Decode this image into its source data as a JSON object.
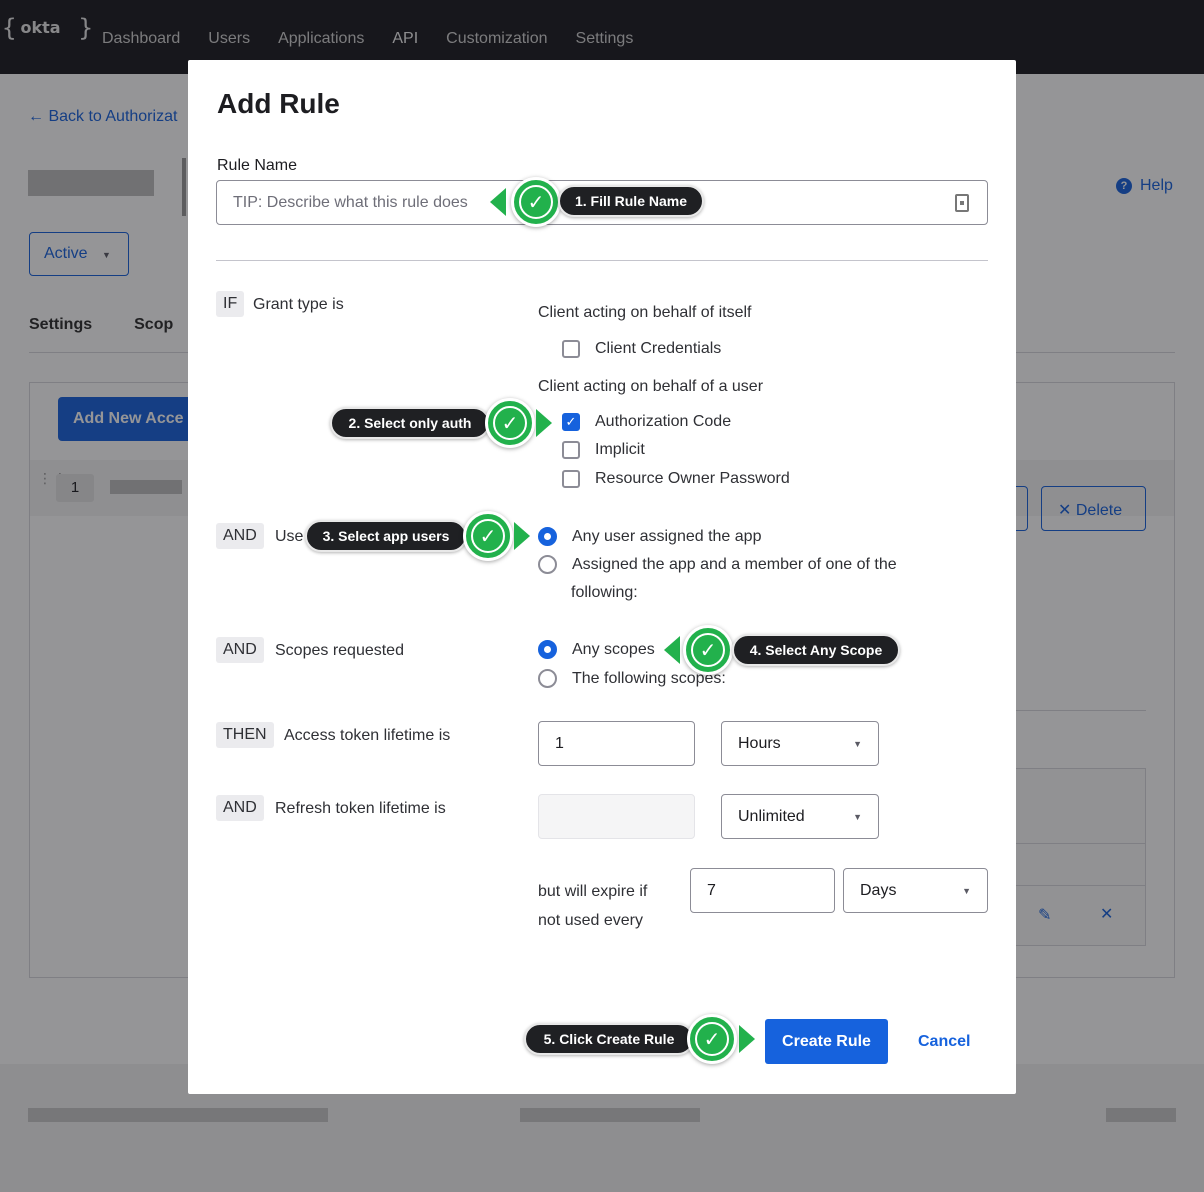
{
  "topbar": {
    "logo_text": "okta",
    "nav": [
      "Dashboard",
      "Users",
      "Applications",
      "API",
      "Customization",
      "Settings"
    ]
  },
  "background": {
    "back_link": "← Back to Authorizat",
    "help": "Help",
    "status_button": "Active",
    "tabs": [
      "Settings",
      "Scop"
    ],
    "add_button": "Add New Acce",
    "row_number": "1",
    "delete_button": "Delete"
  },
  "modal": {
    "title": "Add Rule",
    "rule_name_label": "Rule Name",
    "rule_name_placeholder": "TIP: Describe what this rule does",
    "grant": {
      "tag": "IF",
      "label": "Grant type is",
      "group_self": "Client acting on behalf of itself",
      "client_credentials": "Client Credentials",
      "group_user": "Client acting on behalf of a user",
      "authorization_code": "Authorization Code",
      "implicit": "Implicit",
      "resource_owner": "Resource Owner Password"
    },
    "user": {
      "tag": "AND",
      "label": "Use",
      "any_user": "Any user assigned the app",
      "assigned_member_line1": "Assigned the app and a member of one of the",
      "assigned_member_line2": "following:"
    },
    "scopes": {
      "tag": "AND",
      "label": "Scopes requested",
      "any": "Any scopes",
      "following": "The following scopes:"
    },
    "access_token": {
      "tag": "THEN",
      "label": "Access token lifetime is",
      "value": "1",
      "unit": "Hours"
    },
    "refresh_token": {
      "tag": "AND",
      "label": "Refresh token lifetime is",
      "value": "",
      "unit": "Unlimited"
    },
    "expire": {
      "line1": "but will expire if",
      "line2": "not used every",
      "value": "7",
      "unit": "Days"
    },
    "create_button": "Create Rule",
    "cancel_button": "Cancel"
  },
  "callouts": {
    "step1": "1. Fill Rule Name",
    "step2": "2. Select only auth",
    "step3": "3. Select app users",
    "step4": "4. Select Any Scope",
    "step5": "5. Click Create Rule"
  },
  "colors": {
    "primary": "#1662dd",
    "callout_green": "#22b14c",
    "callout_dark": "#1f2023",
    "topbar": "#1b1b1f"
  }
}
